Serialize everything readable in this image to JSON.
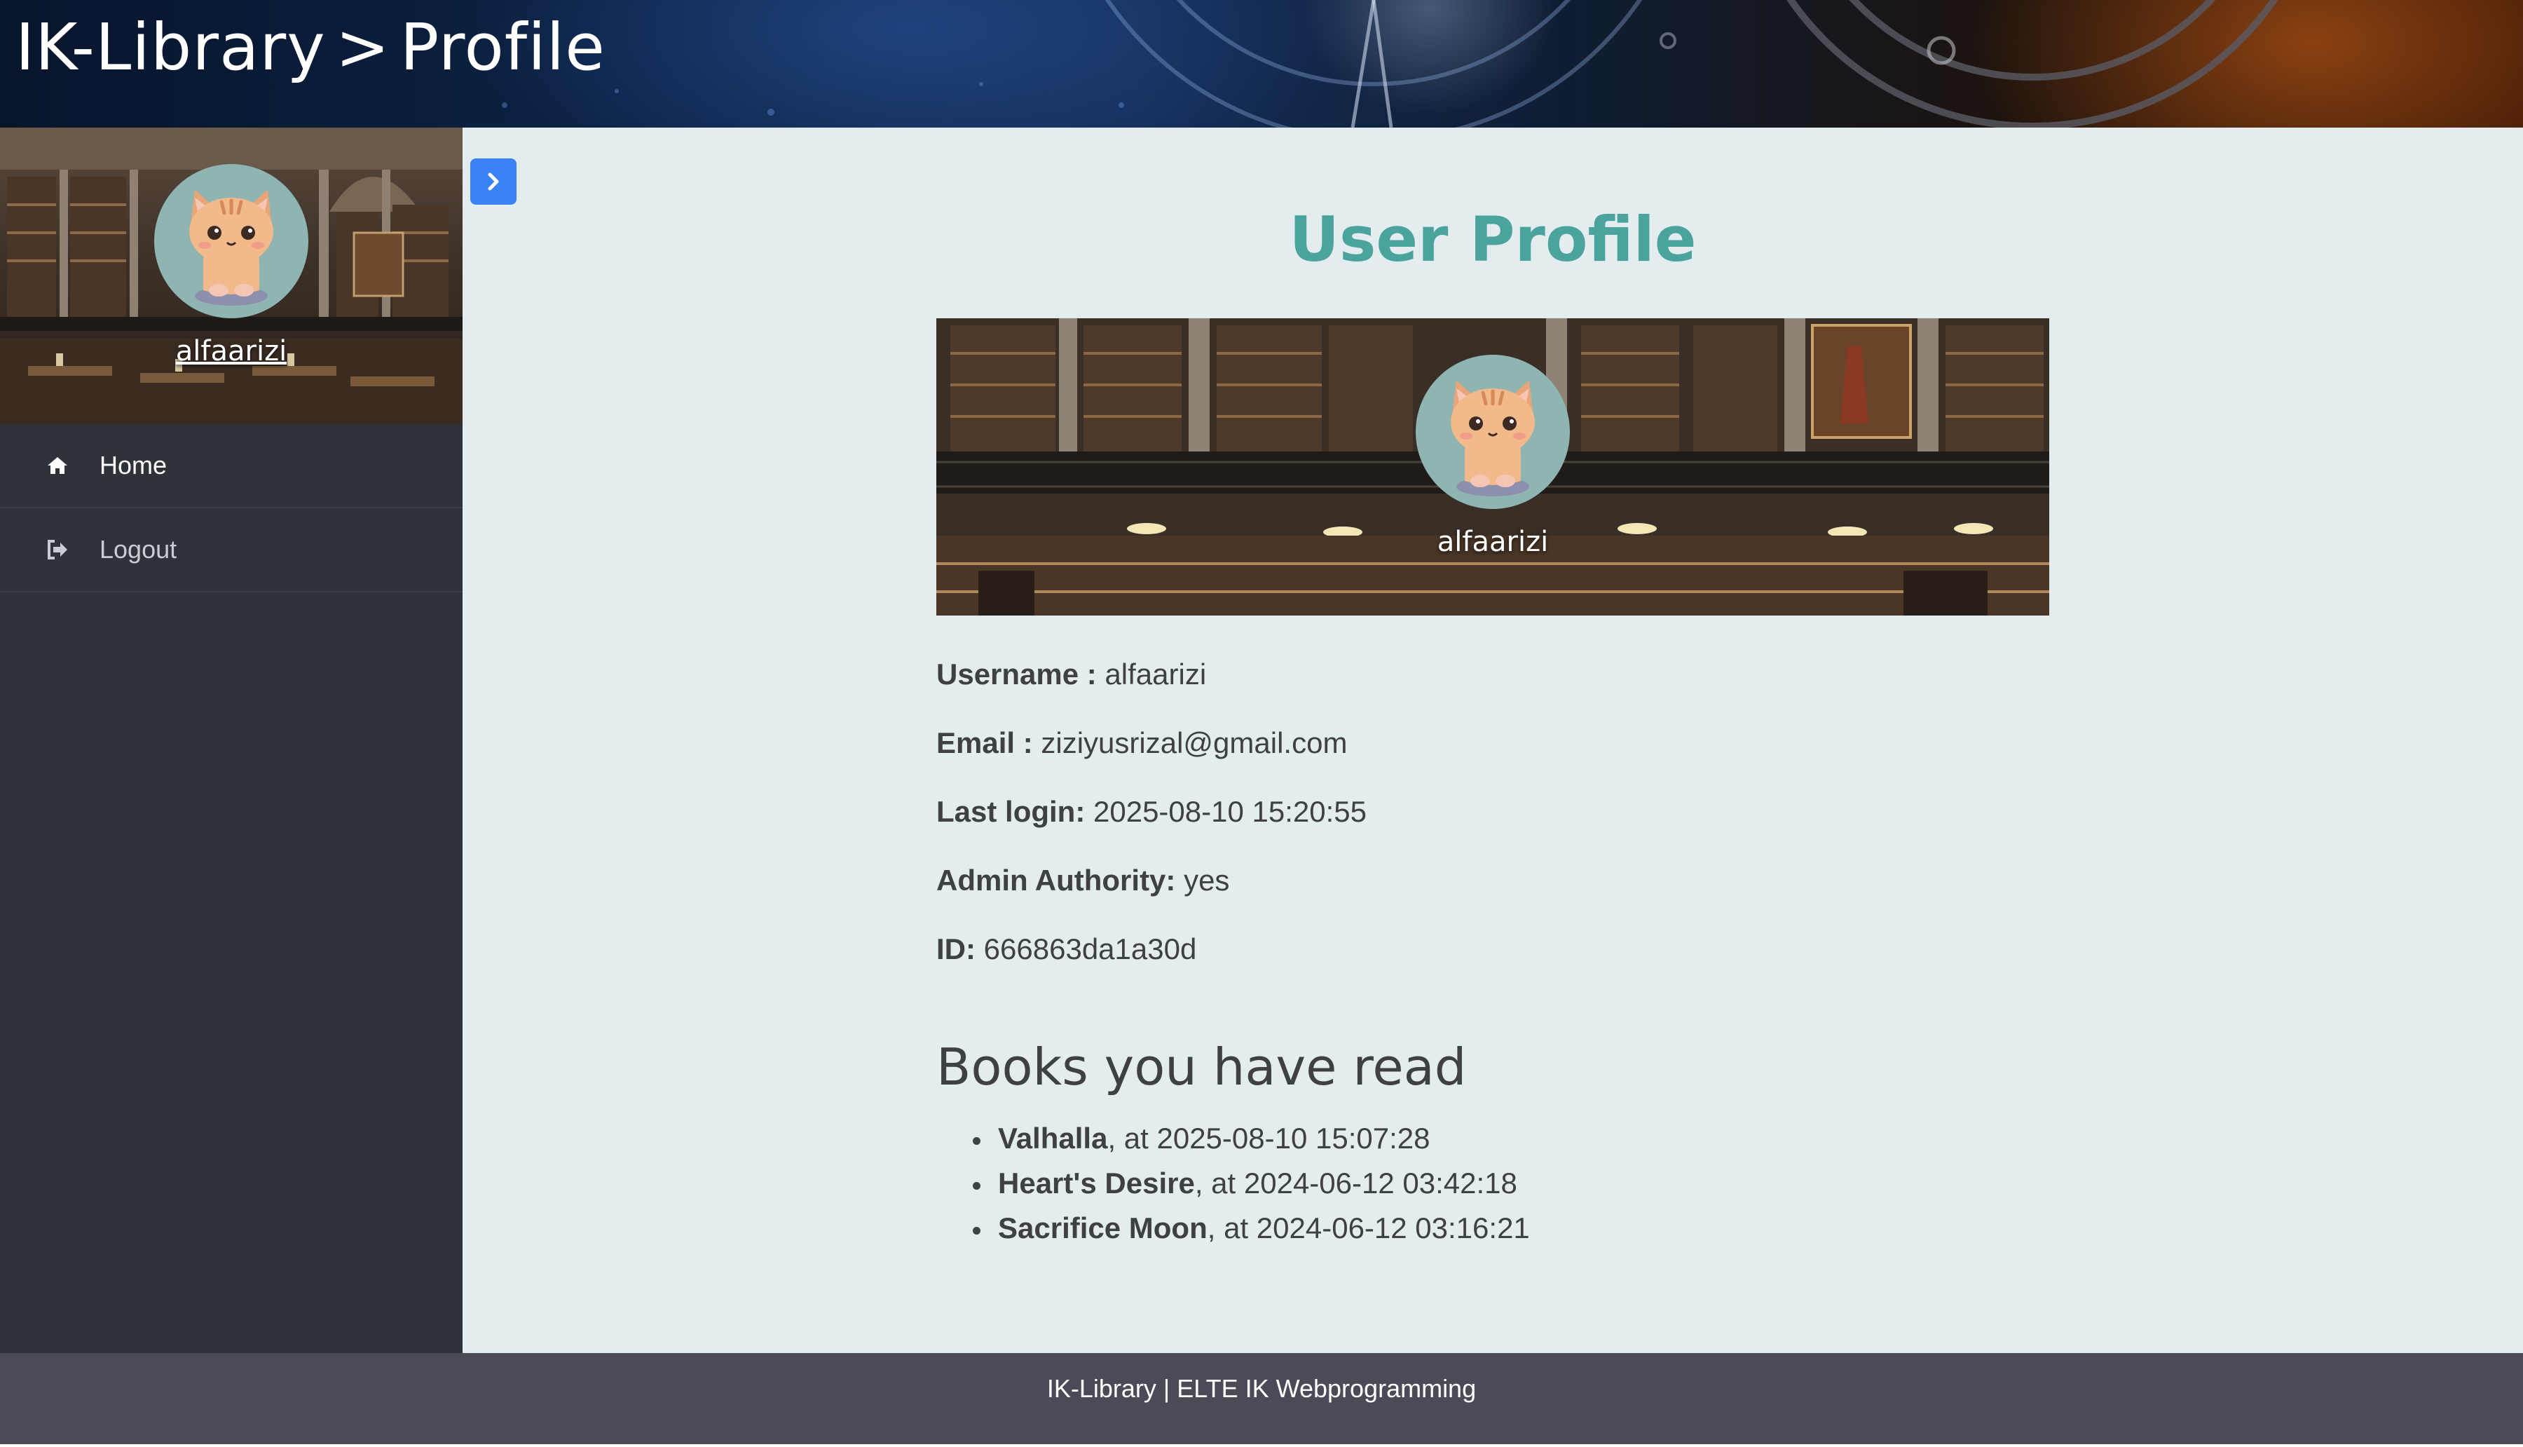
{
  "header": {
    "app_name": "IK-Library",
    "separator": ">",
    "page_name": "Profile"
  },
  "sidebar": {
    "username": "alfaarizi",
    "items": [
      {
        "label": "Home",
        "icon": "home-icon"
      },
      {
        "label": "Logout",
        "icon": "logout-icon"
      }
    ]
  },
  "toggle": {
    "icon": "chevron-right-icon"
  },
  "main": {
    "title": "User Profile",
    "banner_username": "alfaarizi",
    "fields": {
      "username": {
        "label": "Username :",
        "value": "alfaarizi"
      },
      "email": {
        "label": "Email :",
        "value": "ziziyusrizal@gmail.com"
      },
      "last_login": {
        "label": "Last login:",
        "value": "2025-08-10 15:20:55"
      },
      "admin": {
        "label": "Admin Authority:",
        "value": "yes"
      },
      "id": {
        "label": "ID:",
        "value": "666863da1a30d"
      }
    },
    "books_heading": "Books you have read",
    "books": [
      {
        "title": "Valhalla",
        "suffix": ", at 2025-08-10 15:07:28"
      },
      {
        "title": "Heart's Desire",
        "suffix": ", at 2024-06-12 03:42:18"
      },
      {
        "title": "Sacrifice Moon",
        "suffix": ", at 2024-06-12 03:16:21"
      }
    ]
  },
  "footer": {
    "text": "IK-Library | ELTE IK Webprogramming"
  },
  "colors": {
    "accent": "#4aa39c",
    "toggle_button": "#3b82f6",
    "sidebar_bg": "#2f3238",
    "footer_bg": "#4a4b57",
    "main_bg": "#e3ecee"
  }
}
